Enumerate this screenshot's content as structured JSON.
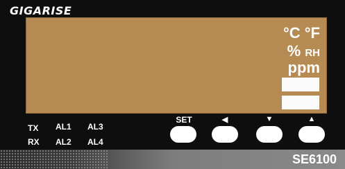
{
  "brand": {
    "logo_text": "GIGARISE"
  },
  "display": {
    "unit_temperature": "°C °F",
    "unit_percent": "%",
    "unit_rh": "RH",
    "unit_ppm": "ppm"
  },
  "indicators": {
    "tx": "TX",
    "rx": "RX",
    "al1": "AL1",
    "al2": "AL2",
    "al3": "AL3",
    "al4": "AL4"
  },
  "buttons": {
    "set_label": "SET",
    "left_label": "◀",
    "down_label": "▼",
    "up_label": "▲"
  },
  "footer": {
    "model": "SE6100"
  },
  "colors": {
    "lcd_background": "#b58a53",
    "panel_background": "#0e0e0e",
    "footer_strip": "#8a8a8a"
  }
}
